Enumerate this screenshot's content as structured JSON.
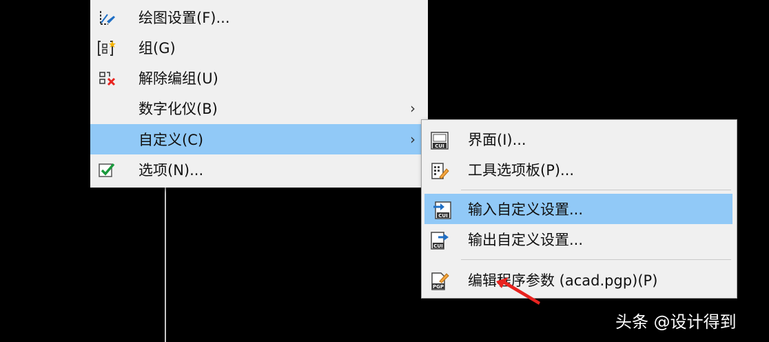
{
  "main_menu": {
    "items": [
      {
        "label": "绘图设置(F)...",
        "icon": "drafting-settings-icon",
        "submenu": false
      },
      {
        "label": "组(G)",
        "icon": "group-icon",
        "submenu": false
      },
      {
        "label": "解除编组(U)",
        "icon": "ungroup-icon",
        "submenu": false
      },
      {
        "label": "数字化仪(B)",
        "icon": "",
        "submenu": true
      },
      {
        "label": "自定义(C)",
        "icon": "",
        "submenu": true,
        "highlighted": true
      },
      {
        "label": "选项(N)...",
        "icon": "options-check-icon",
        "submenu": false
      }
    ],
    "arrow_glyph": "›"
  },
  "customize_submenu": {
    "items": [
      {
        "label": "界面(I)...",
        "icon": "cui-interface-icon"
      },
      {
        "label": "工具选项板(P)...",
        "icon": "tool-palettes-icon"
      },
      {
        "label": "输入自定义设置...",
        "icon": "import-cui-icon",
        "highlighted": true
      },
      {
        "label": "输出自定义设置...",
        "icon": "export-cui-icon"
      },
      {
        "label": "编辑程序参数 (acad.pgp)(P)",
        "icon": "edit-pgp-icon"
      }
    ],
    "icon_badges": {
      "cui": "CUI",
      "pgp": "PGP"
    }
  },
  "watermark": "头条 @设计得到",
  "colors": {
    "highlight": "#91c9f7",
    "menu_bg": "#f0f0f0",
    "accent_blue": "#1f6fc5",
    "check_green": "#1a9a3c",
    "annotation_red": "#e8231f"
  }
}
